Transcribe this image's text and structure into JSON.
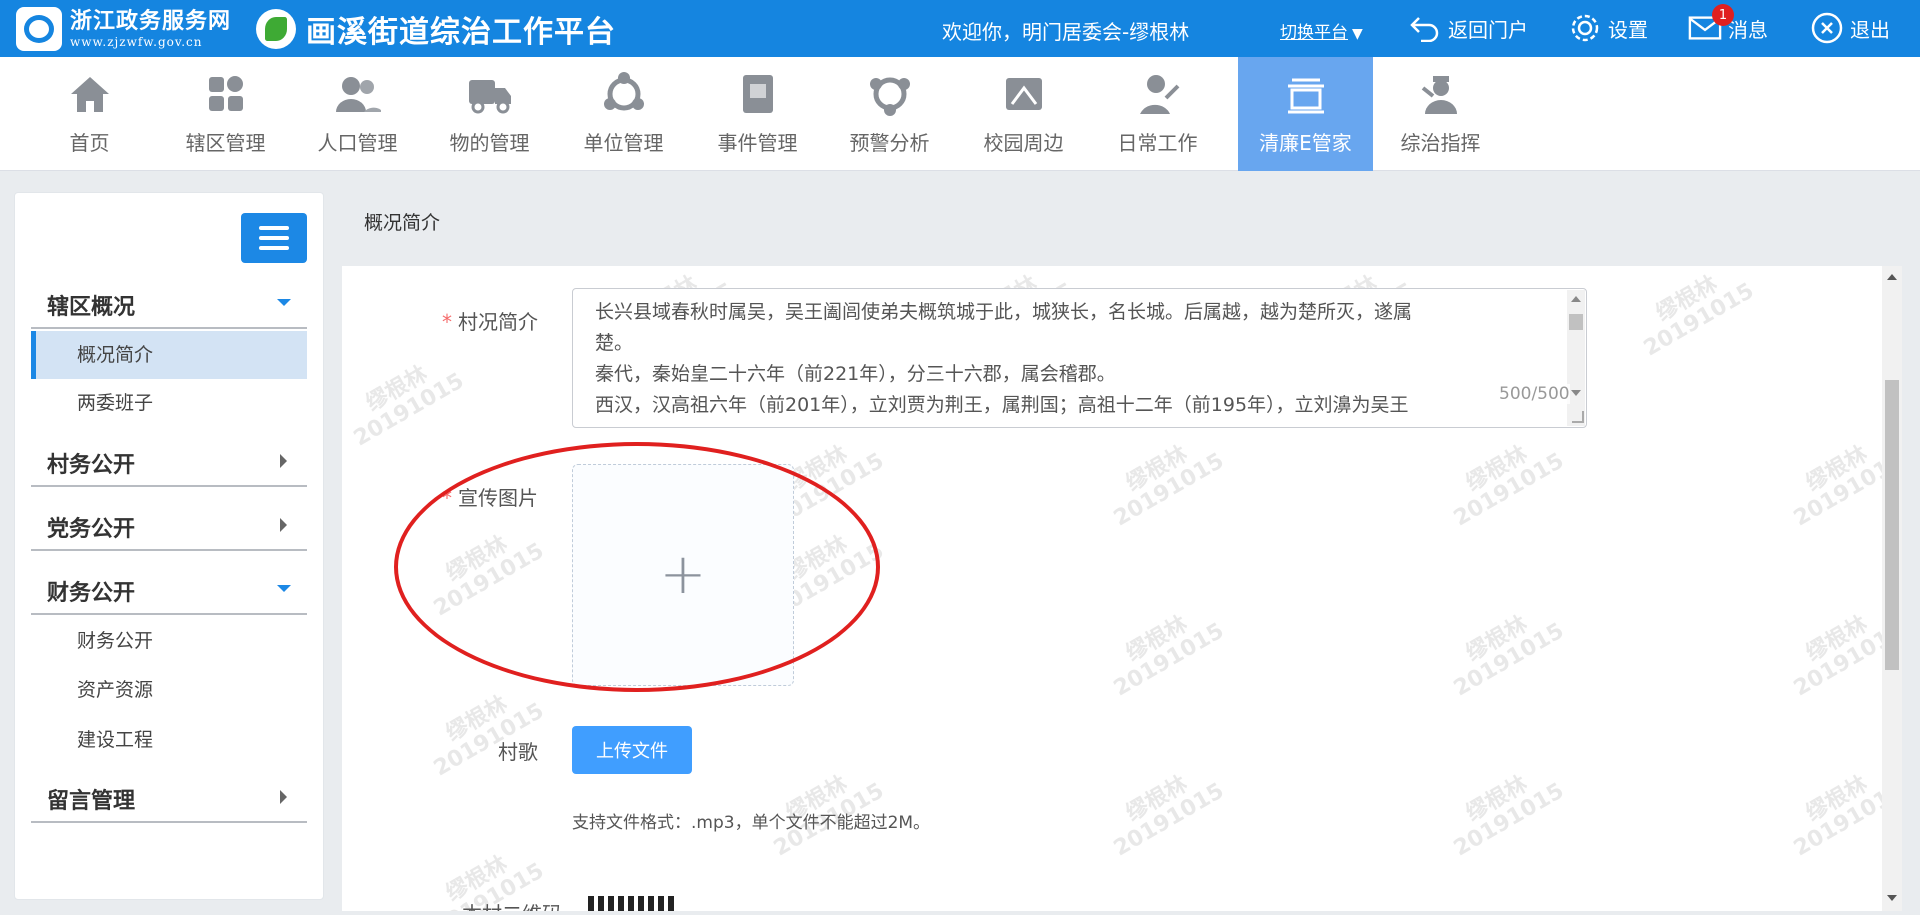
{
  "header": {
    "brand_name": "浙江政务服务网",
    "brand_url": "www.zjzwfw.gov.cn",
    "platform_title": "画溪街道综治工作平台",
    "welcome": "欢迎你，明门居委会-缪根林",
    "switch_platform": "切换平台",
    "switch_caret": "▼",
    "back_portal": "返回门户",
    "settings": "设置",
    "messages": "消息",
    "message_count": "1",
    "logout": "退出"
  },
  "nav": {
    "items": [
      {
        "label": "首页",
        "icon": "home-icon"
      },
      {
        "label": "辖区管理",
        "icon": "grid-icon"
      },
      {
        "label": "人口管理",
        "icon": "people-icon"
      },
      {
        "label": "物的管理",
        "icon": "truck-icon"
      },
      {
        "label": "单位管理",
        "icon": "network-icon"
      },
      {
        "label": "事件管理",
        "icon": "book-icon"
      },
      {
        "label": "预警分析",
        "icon": "alert-network-icon"
      },
      {
        "label": "校园周边",
        "icon": "school-icon"
      },
      {
        "label": "日常工作",
        "icon": "worker-icon"
      },
      {
        "label": "清廉E管家",
        "icon": "clean-gov-icon",
        "active": true
      },
      {
        "label": "综治指挥",
        "icon": "commander-icon"
      }
    ]
  },
  "sidebar": {
    "groups": [
      {
        "title": "辖区概况",
        "expanded": true,
        "items": [
          "概况简介",
          "两委班子"
        ]
      },
      {
        "title": "村务公开",
        "expanded": false,
        "items": []
      },
      {
        "title": "党务公开",
        "expanded": false,
        "items": []
      },
      {
        "title": "财务公开",
        "expanded": true,
        "items": [
          "财务公开",
          "资产资源",
          "建设工程"
        ]
      },
      {
        "title": "留言管理",
        "expanded": false,
        "items": []
      }
    ],
    "active_item": "概况简介"
  },
  "main": {
    "page_title": "概况简介",
    "intro_label": "村况简介",
    "intro_lines": [
      "长兴县域春秋时属吴，吴王阖闾使弟夫概筑城于此，城狭长，名长城。后属越，越为楚所灭，遂属",
      "楚。",
      "秦代，秦始皇二十六年（前221年），分三十六郡，属会稽郡。",
      "西汉，汉高祖六年（前201年），立刘贾为荆王，属荆国；高祖十二年（前195年），立刘濞为吴王"
    ],
    "char_count": "500/500",
    "image_label": "宣传图片",
    "song_label": "村歌",
    "upload_button": "上传文件",
    "upload_hint": "支持文件格式：.mp3，单个文件不能超过2M。",
    "qr_label": "本村二维码",
    "plus_glyph": "+"
  },
  "watermark": {
    "name": "缪根林",
    "date": "20191015"
  },
  "colors": {
    "header_bg": "#1585e0",
    "nav_active": "#68a6ef",
    "accent": "#1c88e5",
    "button": "#409eff",
    "highlight": "#e0201f"
  }
}
